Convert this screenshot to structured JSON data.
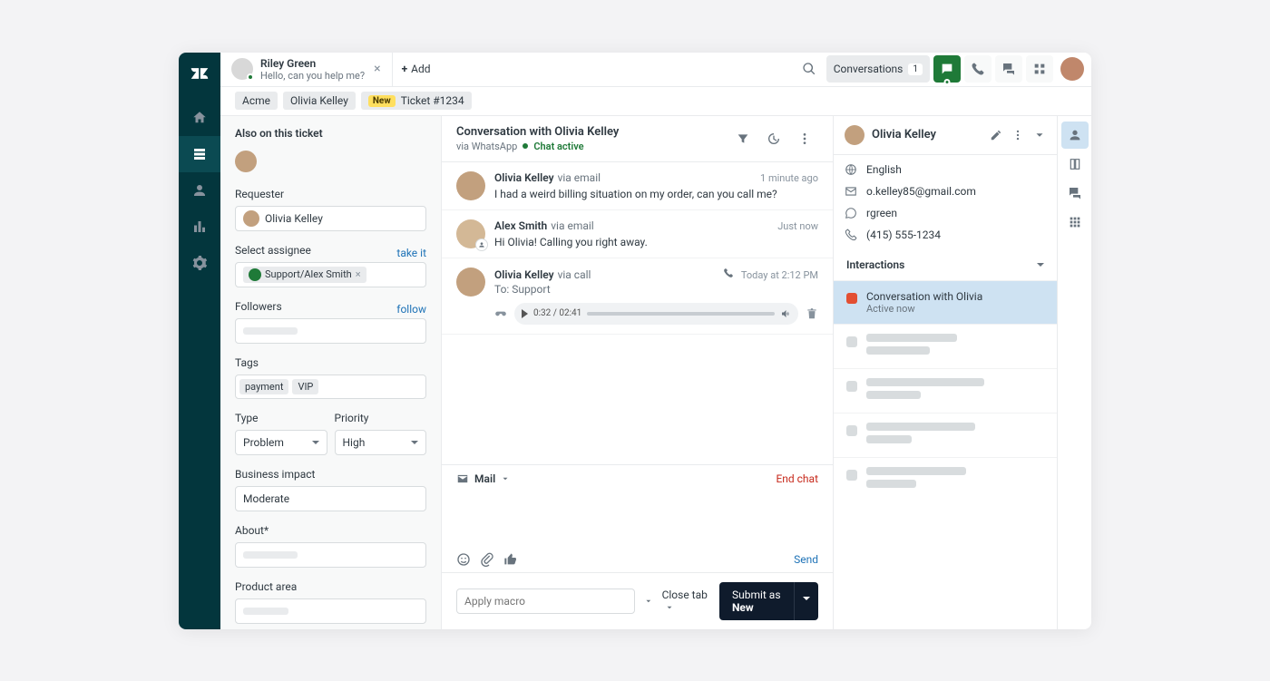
{
  "topbar": {
    "tab": {
      "name": "Riley Green",
      "subtitle": "Hello, can you help me?"
    },
    "add_label": "Add",
    "conversations_label": "Conversations",
    "conversations_count": "1"
  },
  "breadcrumb": {
    "org": "Acme",
    "user": "Olivia Kelley",
    "ticket_new": "New",
    "ticket_label": "Ticket #1234"
  },
  "left": {
    "also_title": "Also on this ticket",
    "requester_label": "Requester",
    "requester_value": "Olivia Kelley",
    "assignee_label": "Select assignee",
    "take_it": "take it",
    "assignee_value": "Support/Alex Smith",
    "followers_label": "Followers",
    "follow": "follow",
    "tags_label": "Tags",
    "tags": [
      "payment",
      "VIP"
    ],
    "type_label": "Type",
    "type_value": "Problem",
    "priority_label": "Priority",
    "priority_value": "High",
    "business_label": "Business impact",
    "business_value": "Moderate",
    "about_label": "About*",
    "product_label": "Product area"
  },
  "center": {
    "title": "Conversation with Olivia Kelley",
    "sub_via": "via WhatsApp",
    "sub_chat": "Chat active",
    "messages": [
      {
        "name": "Olivia Kelley",
        "via": "via email",
        "time": "1 minute ago",
        "body": "I had a weird billing situation on my order, can you call me?"
      },
      {
        "name": "Alex Smith",
        "via": "via email",
        "time": "Just now",
        "body": "Hi Olivia! Calling you right away."
      },
      {
        "name": "Olivia Kelley",
        "via": "via call",
        "time": "Today at 2:12 PM",
        "to": "To: Support",
        "audio_time": "0:32 / 02:41"
      }
    ],
    "compose_channel": "Mail",
    "end_chat": "End chat",
    "send": "Send",
    "macro_placeholder": "Apply macro",
    "close_tab": "Close tab",
    "submit_prefix": "Submit as ",
    "submit_status": "New"
  },
  "right": {
    "name": "Olivia Kelley",
    "language": "English",
    "email": "o.kelley85@gmail.com",
    "handle": "rgreen",
    "phone": "(415) 555-1234",
    "interactions_title": "Interactions",
    "active": {
      "title": "Conversation with Olivia",
      "sub": "Active now"
    }
  }
}
